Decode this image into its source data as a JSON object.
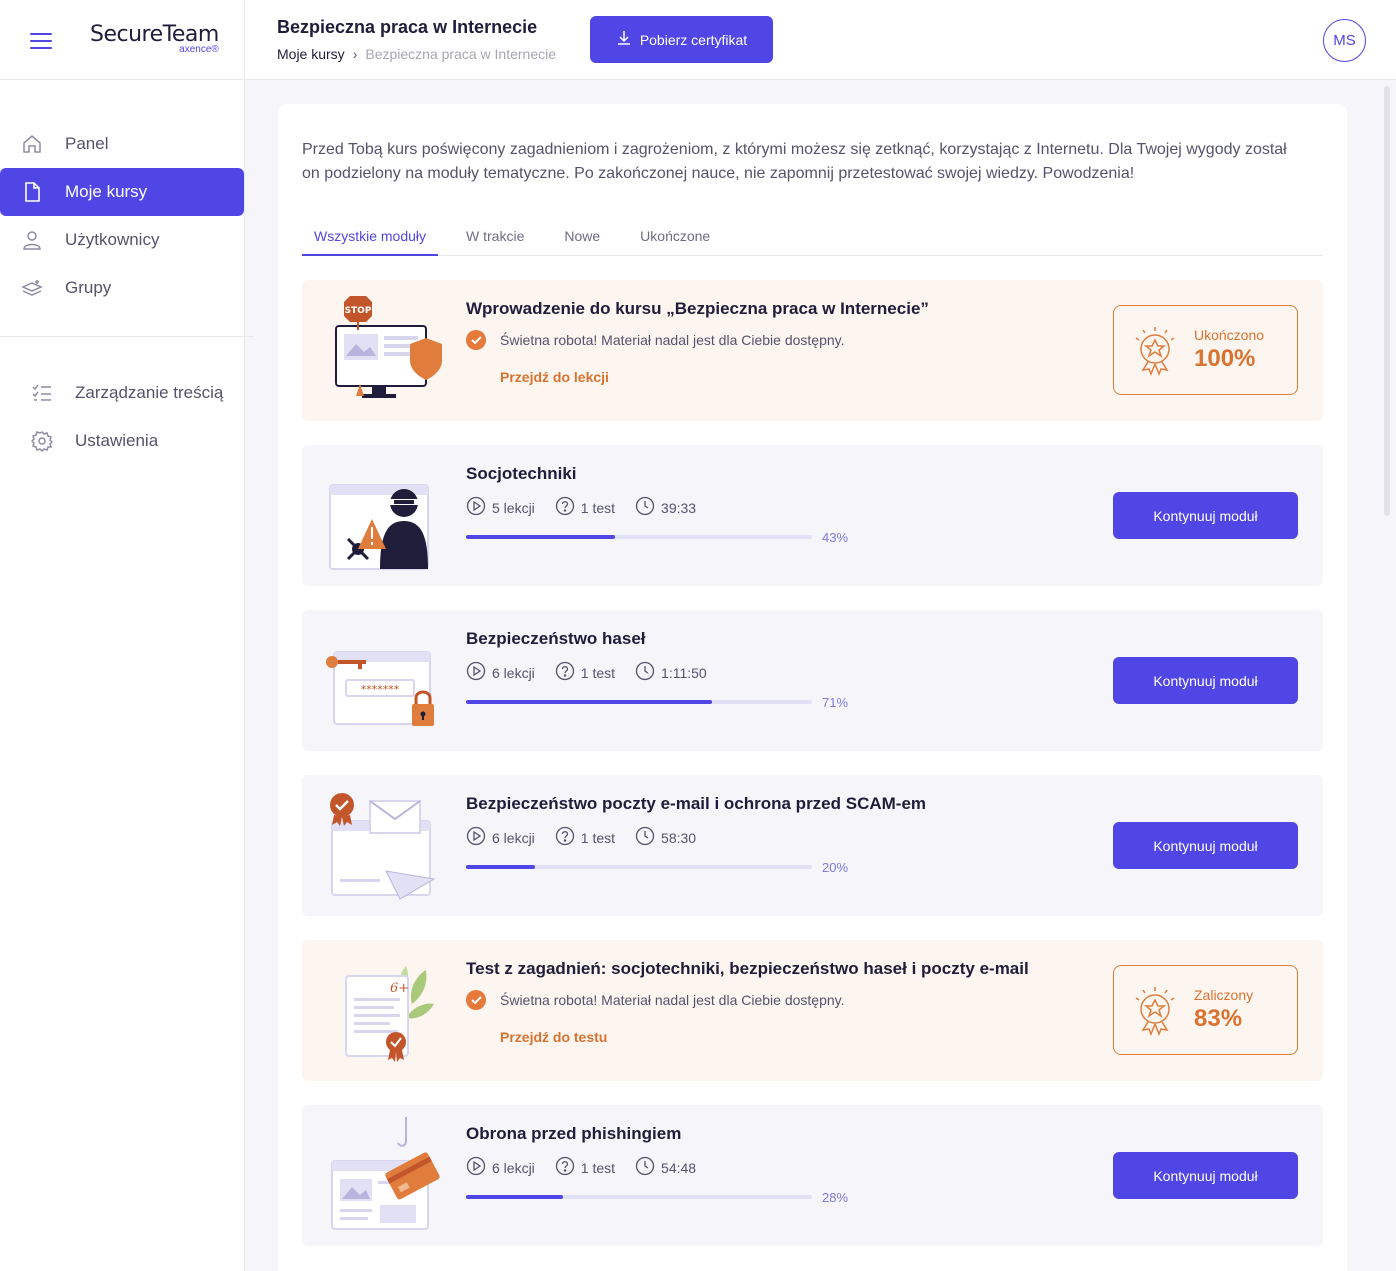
{
  "app": {
    "logo_main": "SecureTeam",
    "logo_sub": "axence®"
  },
  "sidebar": {
    "items": [
      {
        "label": "Panel",
        "icon": "home-icon"
      },
      {
        "label": "Moje kursy",
        "icon": "document-icon",
        "active": true
      },
      {
        "label": "Użytkownicy",
        "icon": "user-icon"
      },
      {
        "label": "Grupy",
        "icon": "layers-icon"
      }
    ],
    "items2": [
      {
        "label": "Zarządzanie treścią",
        "icon": "checklist-icon"
      },
      {
        "label": "Ustawienia",
        "icon": "gear-icon"
      }
    ]
  },
  "header": {
    "title": "Bezpieczna praca w Internecie",
    "breadcrumb": {
      "root": "Moje kursy",
      "sep": "›",
      "current": "Bezpieczna praca w Internecie"
    },
    "cert_button": "Pobierz certyfikat",
    "avatar": "MS"
  },
  "main": {
    "intro": "Przed Tobą kurs poświęcony zagadnieniom i zagrożeniom, z którymi możesz się zetknąć, korzystając z Internetu. Dla Twojej wygody został on podzielony na moduły tematyczne. Po zakończonej nauce, nie zapomnij przetestować swojej wiedzy. Powodzenia!",
    "tabs": [
      "Wszystkie moduły",
      "W trakcie",
      "Nowe",
      "Ukończone"
    ],
    "modules": [
      {
        "title": "Wprowadzenie do kursu „Bezpieczna praca w Internecie”",
        "done": true,
        "message": "Świetna robota! Materiał nadal jest dla Ciebie dostępny.",
        "link": "Przejdź do lekcji",
        "status_label": "Ukończono",
        "status_value": "100%"
      },
      {
        "title": "Socjotechniki",
        "lessons": "5 lekcji",
        "tests": "1 test",
        "time": "39:33",
        "progress": 43,
        "progress_label": "43%",
        "button": "Kontynuuj moduł"
      },
      {
        "title": "Bezpieczeństwo haseł",
        "lessons": "6 lekcji",
        "tests": "1 test",
        "time": "1:11:50",
        "progress": 71,
        "progress_label": "71%",
        "button": "Kontynuuj moduł"
      },
      {
        "title": "Bezpieczeństwo poczty e-mail i ochrona przed SCAM-em",
        "lessons": "6 lekcji",
        "tests": "1 test",
        "time": "58:30",
        "progress": 20,
        "progress_label": "20%",
        "button": "Kontynuuj moduł"
      },
      {
        "title": "Test z zagadnień: socjotechniki, bezpieczeństwo haseł i poczty e-mail",
        "done": true,
        "message": "Świetna robota! Materiał nadal jest dla Ciebie dostępny.",
        "link": "Przejdź do testu",
        "status_label": "Zaliczony",
        "status_value": "83%"
      },
      {
        "title": "Obrona przed phishingiem",
        "lessons": "6 lekcji",
        "tests": "1 test",
        "time": "54:48",
        "progress": 28,
        "progress_label": "28%",
        "button": "Kontynuuj moduł"
      }
    ]
  },
  "colors": {
    "accent": "#5046e5",
    "orange": "#d9732f",
    "done_bg": "#fcf5f0"
  }
}
